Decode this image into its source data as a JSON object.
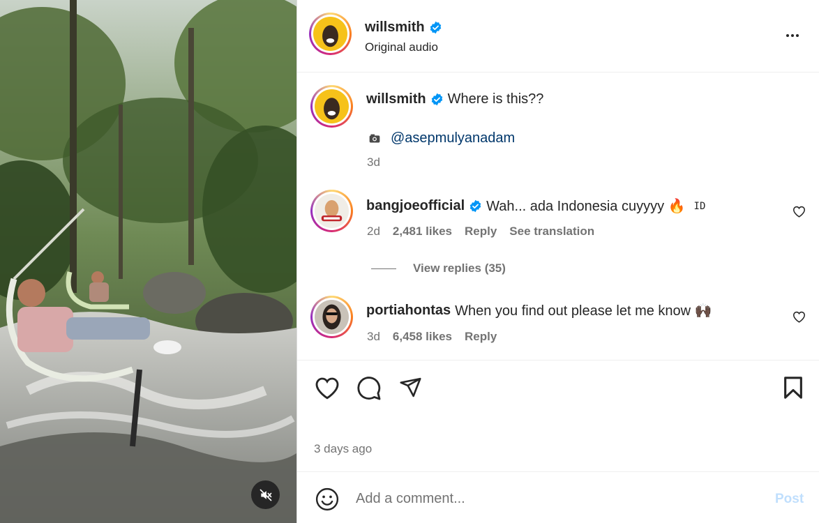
{
  "post": {
    "author": "willsmith",
    "audio": "Original audio",
    "caption": "Where is this??",
    "mention": "@asepmulyanadam",
    "age": "3d",
    "time_ago": "3 days ago",
    "more_icon": "more-horizontal-icon",
    "media_sound": "muted"
  },
  "comments": [
    {
      "user": "bangjoeofficial",
      "verified": true,
      "text": "Wah... ada Indonesia cuyyyy 🔥",
      "tag": "ID",
      "age": "2d",
      "likes": "2,481 likes",
      "reply": "Reply",
      "translate": "See translation",
      "view_replies": "View replies (35)"
    },
    {
      "user": "portiahontas",
      "verified": false,
      "text": "When you find out please let me know 🙌🏿",
      "age": "3d",
      "likes": "6,458 likes",
      "reply": "Reply"
    }
  ],
  "composer": {
    "placeholder": "Add a comment...",
    "post_label": "Post"
  },
  "colors": {
    "verified": "#0095f6",
    "link": "#00376b",
    "muted": "#737373",
    "post_disabled": "#c0dffd"
  }
}
